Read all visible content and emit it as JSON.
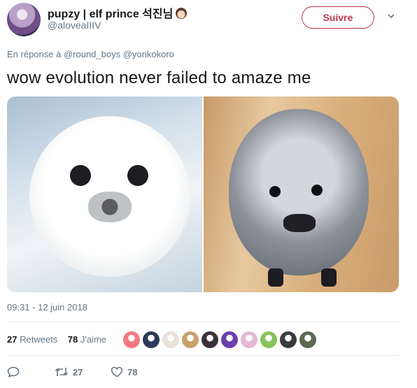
{
  "user": {
    "display_name": "pupzy | elf prince 석진님",
    "handle": "@aloveaIIIV"
  },
  "follow_button": {
    "label": "Suivre"
  },
  "reply": {
    "prefix": "En réponse à",
    "mentions": [
      "@round_boys",
      "@yorikokoro"
    ]
  },
  "tweet": {
    "text": "wow evolution never failed to amaze me",
    "timestamp": "09:31 - 12 juin 2018"
  },
  "stats": {
    "retweets_count": "27",
    "retweets_label": "Retweets",
    "likes_count": "78",
    "likes_label": "J'aime"
  },
  "likers": [
    {
      "icon": "liker-avatar-1",
      "color": "#f2787e"
    },
    {
      "icon": "liker-avatar-2",
      "color": "#2d3a59"
    },
    {
      "icon": "liker-avatar-3",
      "color": "#e9e3d8"
    },
    {
      "icon": "liker-avatar-4",
      "color": "#c9a26d"
    },
    {
      "icon": "liker-avatar-5",
      "color": "#3a3138"
    },
    {
      "icon": "liker-avatar-6",
      "color": "#6d3fa8"
    },
    {
      "icon": "liker-avatar-7",
      "color": "#e6b8d4"
    },
    {
      "icon": "liker-avatar-8",
      "color": "#86c35a"
    },
    {
      "icon": "liker-avatar-9",
      "color": "#3b3b3b"
    },
    {
      "icon": "liker-avatar-10",
      "color": "#5c6b4f"
    }
  ],
  "actions": {
    "reply_icon": "reply-icon",
    "retweet_count": "27",
    "like_count": "78"
  },
  "colors": {
    "follow_accent": "#c0354a",
    "muted": "#657786",
    "text": "#14171a"
  }
}
